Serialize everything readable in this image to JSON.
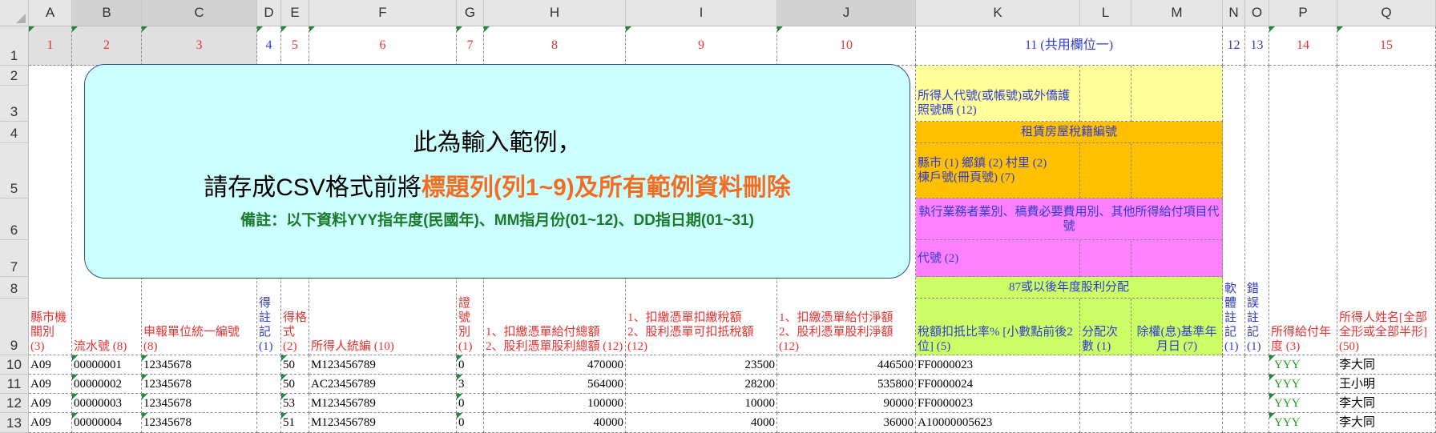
{
  "columns": [
    "A",
    "B",
    "C",
    "D",
    "E",
    "F",
    "G",
    "H",
    "I",
    "J",
    "K",
    "L",
    "M",
    "N",
    "O",
    "P",
    "Q"
  ],
  "rows": [
    "1",
    "2",
    "3",
    "4",
    "5",
    "6",
    "7",
    "8",
    "9",
    "10",
    "11",
    "12",
    "13"
  ],
  "row1": [
    "1",
    "2",
    "3",
    "4",
    "5",
    "6",
    "7",
    "8",
    "9",
    "10",
    "11 (共用欄位一)",
    "12",
    "13",
    "14",
    "15"
  ],
  "header9": {
    "a": "縣市機關別 (3)",
    "b": "流水號 (8)",
    "c": "申報單位統一編號 (8)",
    "d": "得註記 (1)",
    "e": "得格式 (2)",
    "f": "所得人統編 (10)",
    "g": "證號別 (1)",
    "h": "1、扣繳憑單給付總額\n2、股利憑單股利總額 (12)",
    "i": "1、扣繳憑單扣繳稅額\n2、股利憑單可扣抵稅額 (12)",
    "j": "1、扣繳憑單給付淨額\n2、股利憑單股利淨額 (12)",
    "k": "稅額扣抵比率% [小數點前後2位] (5)",
    "l": "分配次數 (1)",
    "m": "除權(息)基準年月日 (7)",
    "n": "軟體註記 (1)",
    "o": "錯誤註記 (1)",
    "p": "所得給付年度 (3)",
    "q": "所得人姓名[全部全形或全部半形] (50)"
  },
  "shared": {
    "r23": "所得人代號(或帳號)或外僑護照號碼 (12)",
    "r4": "租賃房屋稅籍編號",
    "r5": "縣市 (1) 鄉鎮 (2) 村里 (2)\n棟戶號(冊頁號) (7)",
    "r6": "執行業務者業別、稿費必要費用別、其他所得給付項目代號",
    "r7": "代號 (2)",
    "r8": "87或以後年度股利分配"
  },
  "callout": {
    "line1": "此為輸入範例，",
    "line2_prefix": "請存成CSV格式前將",
    "line2_highlight": "標題列(列1~9)及所有範例資料刪除",
    "line3": "備註：以下資料YYY指年度(民國年)、MM指月份(01~12)、DD指日期(01~31)"
  },
  "data_rows": [
    {
      "a": "A09",
      "b": "00000001",
      "c": "12345678",
      "e": "50",
      "f": "M123456789",
      "g": "0",
      "h": "470000",
      "i": "23500",
      "j": "446500",
      "k": "FF0000023",
      "p": "YYY",
      "q": "李大同"
    },
    {
      "a": "A09",
      "b": "00000002",
      "c": "12345678",
      "e": "50",
      "f": "AC23456789",
      "g": "3",
      "h": "564000",
      "i": "28200",
      "j": "535800",
      "k": "FF0000024",
      "p": "YYY",
      "q": "王小明"
    },
    {
      "a": "A09",
      "b": "00000003",
      "c": "12345678",
      "e": "53",
      "f": "M123456789",
      "g": "0",
      "h": "100000",
      "i": "10000",
      "j": "90000",
      "k": "FF0000023",
      "p": "YYY",
      "q": "李大同"
    },
    {
      "a": "A09",
      "b": "00000004",
      "c": "12345678",
      "e": "51",
      "f": "M123456789",
      "g": "0",
      "h": "40000",
      "i": "4000",
      "j": "36000",
      "k": "A10000005623",
      "p": "YYY",
      "q": "李大同"
    }
  ],
  "colors": {
    "red_header": "#e8322f",
    "blue_header": "#2f3bd1",
    "callout_bg": "#ccffff",
    "highlight": "#f26d21",
    "note_green": "#1a7a2a",
    "yellow": "#ffff99",
    "orange": "#ffc000",
    "pink": "#ff80ff",
    "lime": "#ccff66",
    "text_green": "#1b9b1b"
  }
}
